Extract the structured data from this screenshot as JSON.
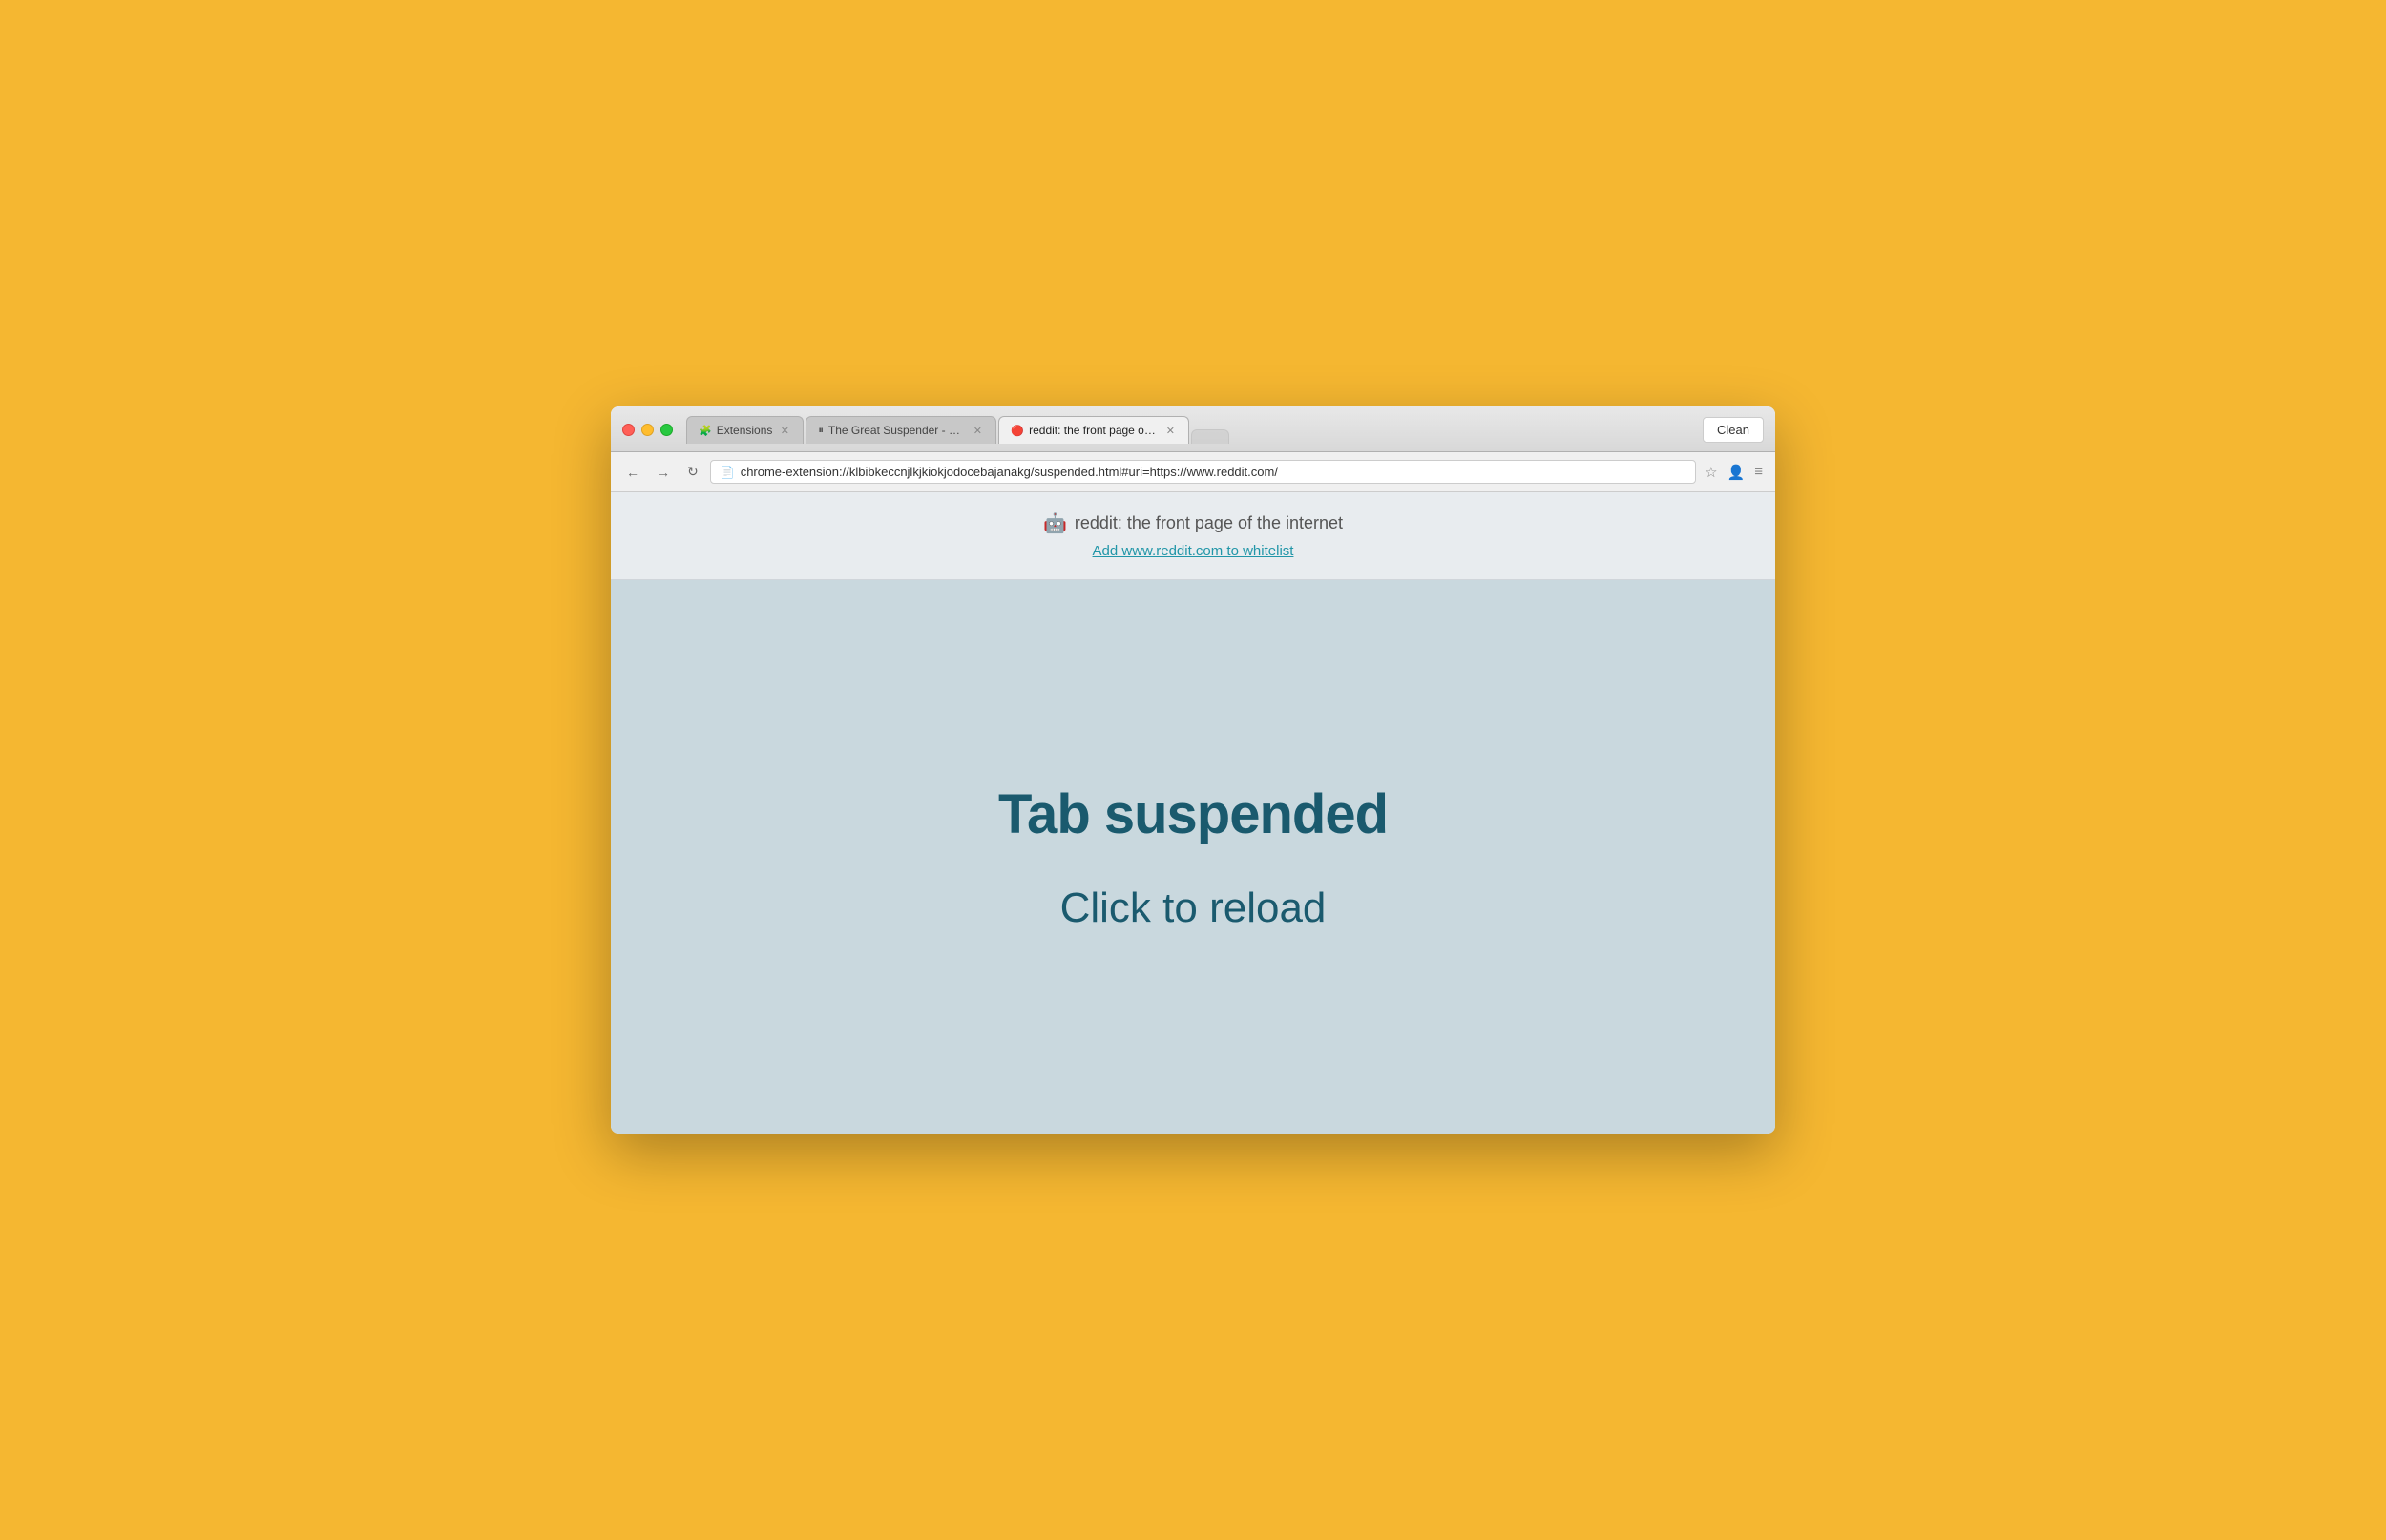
{
  "desktop": {
    "bg_color": "#F5B731"
  },
  "browser": {
    "clean_button_label": "Clean",
    "tabs": [
      {
        "id": "tab-extensions",
        "icon": "🧩",
        "label": "Extensions",
        "active": false,
        "closable": true
      },
      {
        "id": "tab-great-suspender",
        "icon": "⏸",
        "label": "The Great Suspender - Ch…",
        "active": false,
        "closable": true
      },
      {
        "id": "tab-reddit",
        "icon": "🔴",
        "label": "reddit: the front page of th…",
        "active": true,
        "closable": true
      },
      {
        "id": "tab-empty",
        "icon": "",
        "label": "",
        "active": false,
        "closable": false
      }
    ],
    "nav": {
      "back_disabled": false,
      "forward_disabled": false,
      "address": "chrome-extension://klbibkeccnjlkjkiokjodocebajanakg/suspended.html#uri=https://www.reddit.com/"
    },
    "page": {
      "site_icon": "🤖",
      "title": "reddit: the front page of the internet",
      "whitelist_link": "Add www.reddit.com to whitelist",
      "suspended_heading": "Tab suspended",
      "reload_text": "Click to reload"
    }
  }
}
